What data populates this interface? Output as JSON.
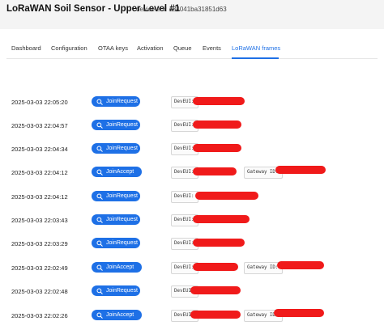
{
  "header": {
    "title": "LoRaWAN Soil Sensor - Upper Level #1",
    "device_eui": "device eui: a84041ba31851d63"
  },
  "tabs": [
    {
      "label": "Dashboard"
    },
    {
      "label": "Configuration"
    },
    {
      "label": "OTAA keys"
    },
    {
      "label": "Activation"
    },
    {
      "label": "Queue"
    },
    {
      "label": "Events"
    },
    {
      "label": "LoRaWAN frames",
      "active": true
    }
  ],
  "frames": [
    {
      "timestamp": "2025-03-03 22:05:20",
      "type": "JoinRequest",
      "dev_eui_label": "DevEUI:"
    },
    {
      "timestamp": "2025-03-03 22:04:57",
      "type": "JoinRequest",
      "dev_eui_label": "DevEUI:"
    },
    {
      "timestamp": "2025-03-03 22:04:34",
      "type": "JoinRequest",
      "dev_eui_label": "DevEUI:"
    },
    {
      "timestamp": "2025-03-03 22:04:12",
      "type": "JoinAccept",
      "dev_eui_label": "DevEUI:",
      "gateway_label": "Gateway ID:"
    },
    {
      "timestamp": "2025-03-03 22:04:12",
      "type": "JoinRequest",
      "dev_eui_label": "DevEUI:"
    },
    {
      "timestamp": "2025-03-03 22:03:43",
      "type": "JoinRequest",
      "dev_eui_label": "DevEUI:"
    },
    {
      "timestamp": "2025-03-03 22:03:29",
      "type": "JoinRequest",
      "dev_eui_label": "DevEUI:"
    },
    {
      "timestamp": "2025-03-03 22:02:49",
      "type": "JoinAccept",
      "dev_eui_label": "DevEUI:",
      "gateway_label": "Gateway ID:"
    },
    {
      "timestamp": "2025-03-03 22:02:48",
      "type": "JoinRequest",
      "dev_eui_label": "DevEUI:"
    },
    {
      "timestamp": "2025-03-03 22:02:26",
      "type": "JoinAccept",
      "dev_eui_label": "DevEUI:",
      "gateway_label": "Gateway ID:"
    }
  ],
  "icons": {
    "badge_icon": "search-icon"
  },
  "colors": {
    "accent": "#1e70e6",
    "redaction": "#f01a1a"
  }
}
